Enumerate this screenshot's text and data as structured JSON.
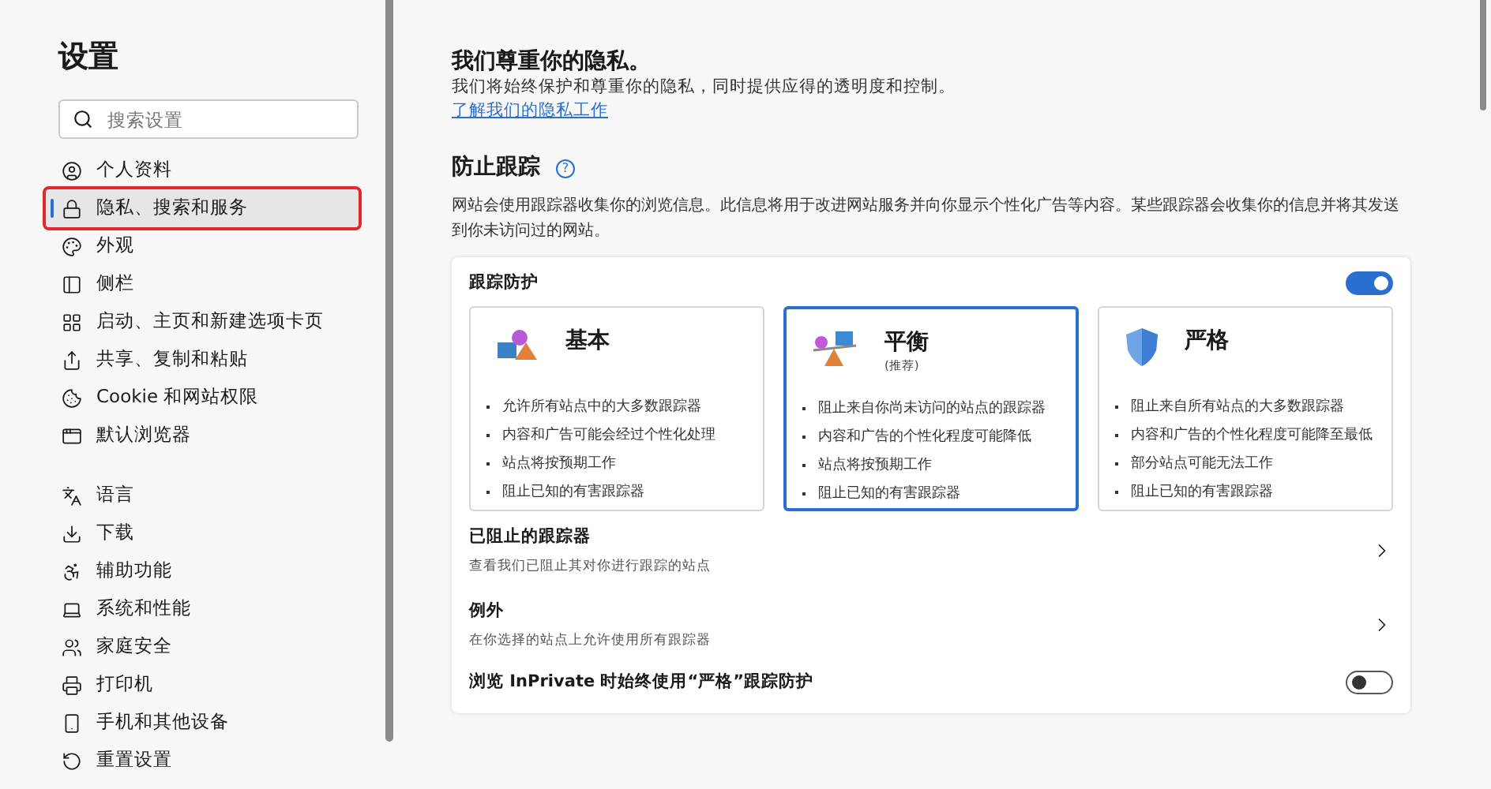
{
  "sidebar": {
    "title": "设置",
    "search": {
      "placeholder": "搜索设置"
    },
    "groups": [
      [
        {
          "label": "个人资料",
          "selected": false
        },
        {
          "label": "隐私、搜索和服务",
          "selected": true
        },
        {
          "label": "外观",
          "selected": false
        },
        {
          "label": "侧栏",
          "selected": false
        },
        {
          "label": "启动、主页和新建选项卡页",
          "selected": false
        },
        {
          "label": "共享、复制和粘贴",
          "selected": false
        },
        {
          "label": "Cookie 和网站权限",
          "selected": false
        },
        {
          "label": "默认浏览器",
          "selected": false
        }
      ],
      [
        {
          "label": "语言",
          "selected": false
        },
        {
          "label": "下载",
          "selected": false
        },
        {
          "label": "辅助功能",
          "selected": false
        },
        {
          "label": "系统和性能",
          "selected": false
        },
        {
          "label": "家庭安全",
          "selected": false
        },
        {
          "label": "打印机",
          "selected": false
        },
        {
          "label": "手机和其他设备",
          "selected": false
        },
        {
          "label": "重置设置",
          "selected": false
        }
      ]
    ]
  },
  "privacy": {
    "title": "我们尊重你的隐私。",
    "text": "我们将始终保护和尊重你的隐私，同时提供应得的透明度和控制。",
    "link": "了解我们的隐私工作"
  },
  "tracking": {
    "title": "防止跟踪",
    "help": "?",
    "description": "网站会使用跟踪器收集你的浏览信息。此信息将用于改进网站服务并向你显示个性化广告等内容。某些跟踪器会收集你的信息并将其发送到你未访问过的网站。",
    "protection": {
      "label": "跟踪防护",
      "on": true
    },
    "levels": [
      {
        "kind": "basic",
        "title": "基本",
        "selected": false,
        "points": [
          "允许所有站点中的大多数跟踪器",
          "内容和广告可能会经过个性化处理",
          "站点将按预期工作",
          "阻止已知的有害跟踪器"
        ]
      },
      {
        "kind": "balanced",
        "title": "平衡",
        "subtitle": "(推荐)",
        "selected": true,
        "points": [
          "阻止来自你尚未访问的站点的跟踪器",
          "内容和广告的个性化程度可能降低",
          "站点将按预期工作",
          "阻止已知的有害跟踪器"
        ]
      },
      {
        "kind": "strict",
        "title": "严格",
        "selected": false,
        "points": [
          "阻止来自所有站点的大多数跟踪器",
          "内容和广告的个性化程度可能降至最低",
          "部分站点可能无法工作",
          "阻止已知的有害跟踪器"
        ]
      }
    ],
    "rows": [
      {
        "kind": "link",
        "title": "已阻止的跟踪器",
        "subtitle": "查看我们已阻止其对你进行跟踪的站点"
      },
      {
        "kind": "link",
        "title": "例外",
        "subtitle": "在你选择的站点上允许使用所有跟踪器"
      },
      {
        "kind": "toggle",
        "title": "浏览 InPrivate 时始终使用“严格”跟踪防护",
        "on": false
      }
    ]
  }
}
